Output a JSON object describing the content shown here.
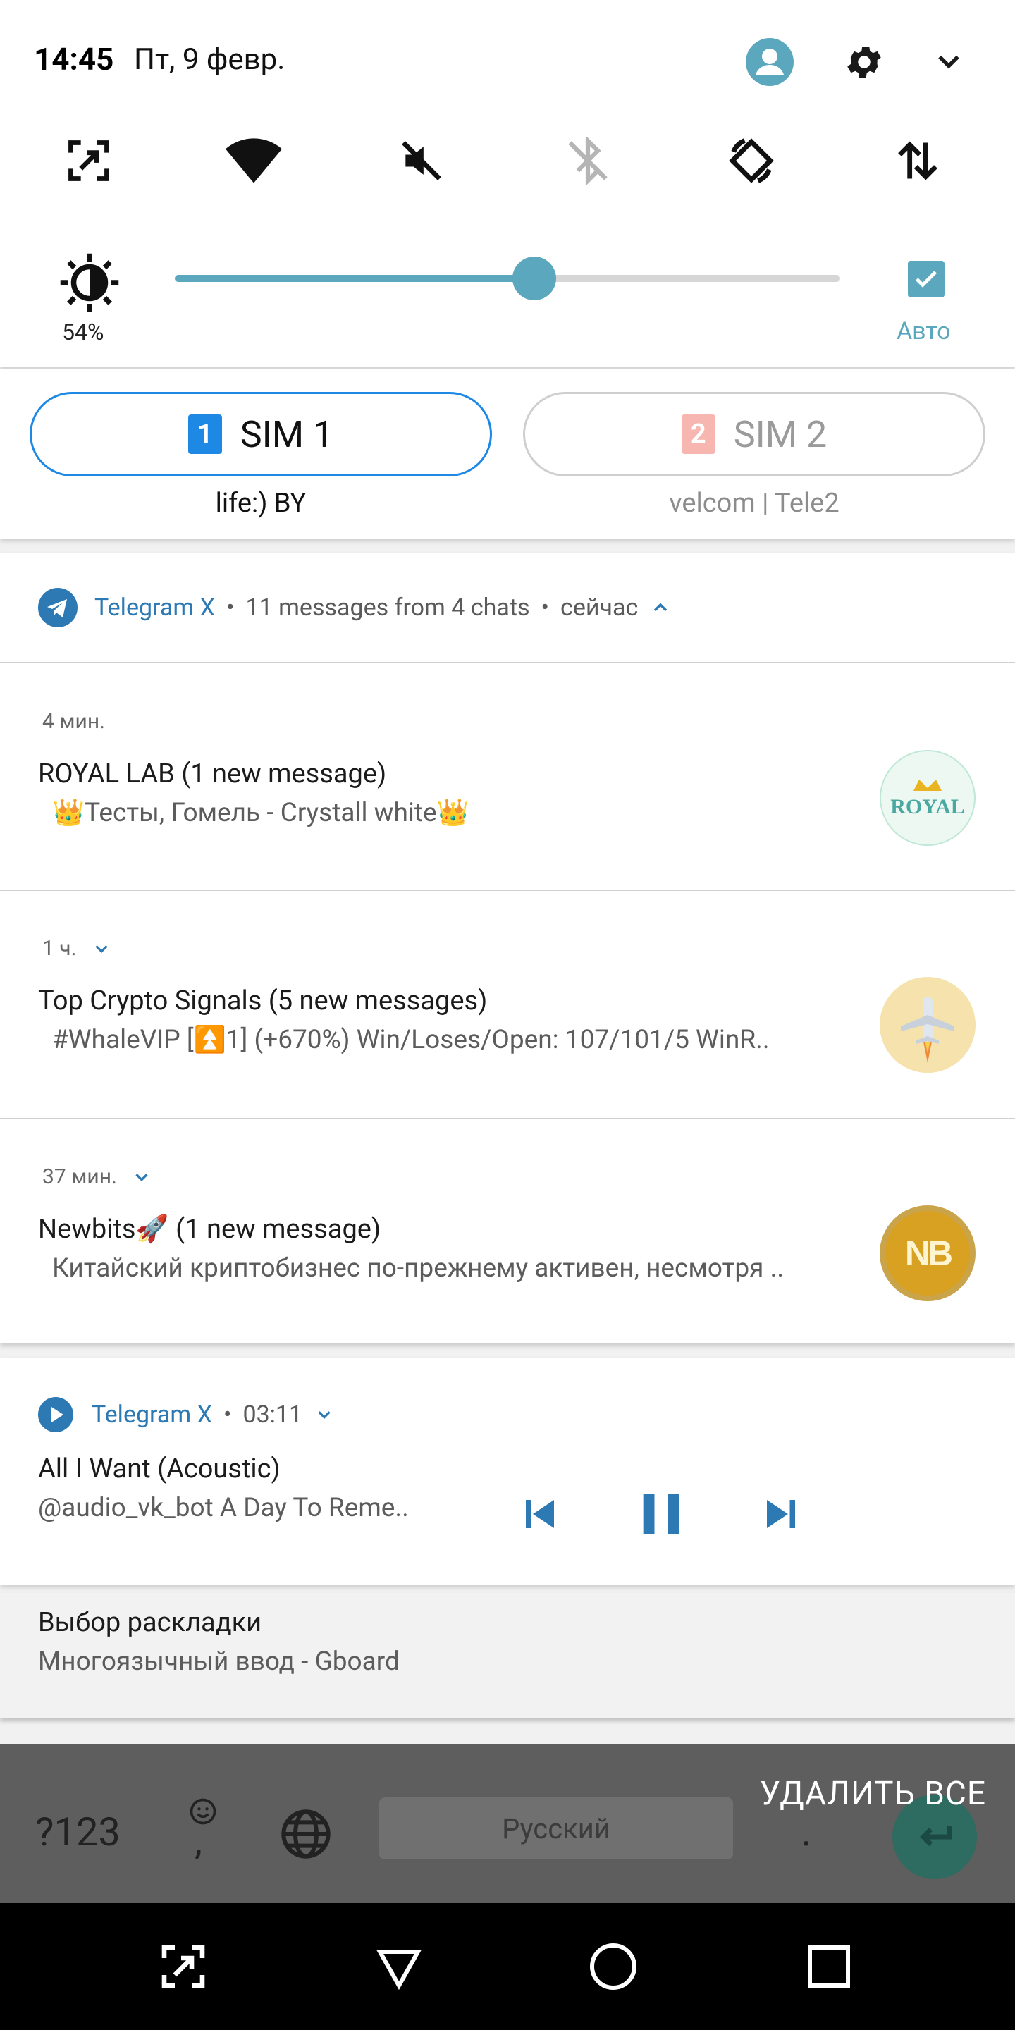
{
  "status_bar": {
    "time": "14:45",
    "date": "Пт, 9 февр."
  },
  "quick_settings": {
    "tiles": [
      {
        "icon": "screenshot-icon"
      },
      {
        "icon": "wifi-icon"
      },
      {
        "icon": "sound-off-icon"
      },
      {
        "icon": "bluetooth-off-icon"
      },
      {
        "icon": "auto-rotate-icon"
      },
      {
        "icon": "mobile-data-icon"
      }
    ],
    "brightness": {
      "value_label": "54%",
      "level_percent": 54,
      "auto_label": "Авто",
      "auto_checked": true
    },
    "accent_color": "#5ba7bd"
  },
  "sim": {
    "sim1": {
      "number": "1",
      "label": "SIM 1",
      "carrier": "life:) BY",
      "selected": true,
      "color": "#1e88e5"
    },
    "sim2": {
      "number": "2",
      "label": "SIM 2",
      "carrier": "velcom | Tele2",
      "selected": false,
      "color": "#f7b7b0"
    }
  },
  "telegram_group": {
    "app_name": "Telegram X",
    "summary": "11 messages from 4 chats",
    "time": "сейчас",
    "messages": [
      {
        "time": "4 мин.",
        "title": "ROYAL LAB (1 new message)",
        "body": "👑Тесты, Гомель - Crystall white👑",
        "avatar": "royal-lab-avatar",
        "avatar_text": "ROYAL"
      },
      {
        "time": "1 ч.",
        "title": "Top Crypto Signals (5 new messages)",
        "body": "#WhaleVIP [⏫1] (+670%)  Win/Loses/Open: 107/101/5 WinR..",
        "avatar": "airplane-avatar"
      },
      {
        "time": "37 мин.",
        "title": "Newbits🚀 (1 new message)",
        "body": "Китайский криптобизнес по-прежнему активен, несмотря ..",
        "avatar": "newbits-avatar",
        "avatar_text": "NB"
      }
    ]
  },
  "music": {
    "app_name": "Telegram X",
    "time": "03:11",
    "title": "All I Want (Acoustic)",
    "subtitle": "@audio_vk_bot A Day To Reme.."
  },
  "keyboard_notification": {
    "title": "Выбор раскладки",
    "body": "Многоязычный ввод - Gboard"
  },
  "keyboard": {
    "symbols_key": "?123",
    "comma_key": ",",
    "space_label": "Русский",
    "period_key": "."
  },
  "clear_all": "УДАЛИТЬ ВСЕ"
}
